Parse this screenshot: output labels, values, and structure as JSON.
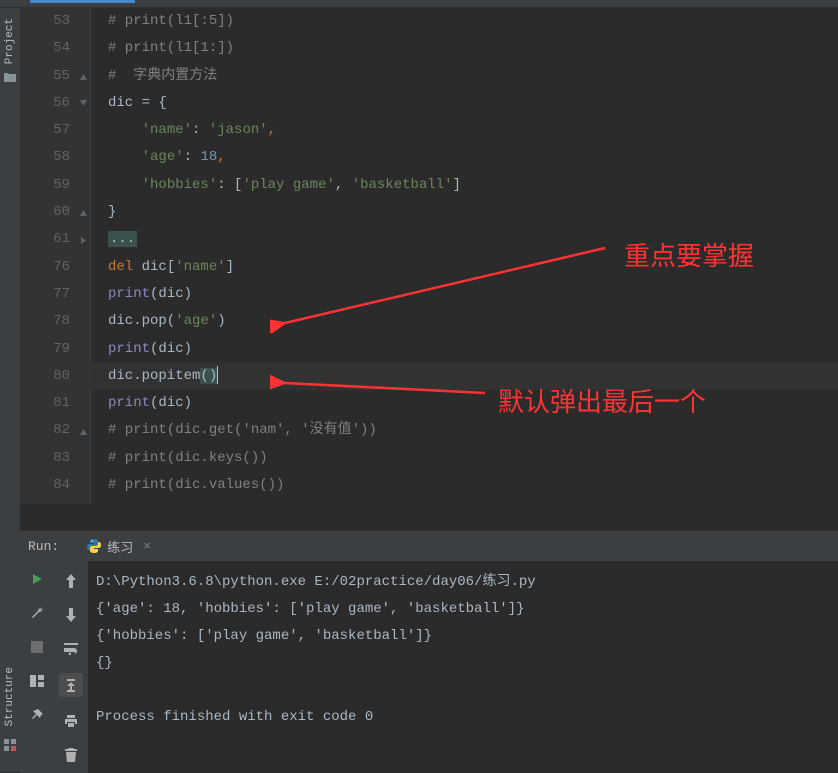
{
  "sidebar": {
    "project_label": "Project",
    "structure_label": "Structure"
  },
  "editor": {
    "lines": [
      {
        "num": "53",
        "tokens": [
          {
            "t": "# print(l1[:5])",
            "c": "c-comment"
          }
        ]
      },
      {
        "num": "54",
        "tokens": [
          {
            "t": "# print(l1[1:])",
            "c": "c-comment"
          }
        ]
      },
      {
        "num": "55",
        "tokens": [
          {
            "t": "#  字典内置方法",
            "c": "c-comment"
          }
        ],
        "fold": "end"
      },
      {
        "num": "56",
        "tokens": [
          {
            "t": "dic = {",
            "c": "c-ident"
          }
        ],
        "fold": "start"
      },
      {
        "num": "57",
        "indent": 1,
        "tokens": [
          {
            "t": "'name'",
            "c": "c-string"
          },
          {
            "t": ": ",
            "c": "c-ident"
          },
          {
            "t": "'jason'",
            "c": "c-string"
          },
          {
            "t": ",",
            "c": "c-punct"
          }
        ]
      },
      {
        "num": "58",
        "indent": 1,
        "tokens": [
          {
            "t": "'age'",
            "c": "c-string"
          },
          {
            "t": ": ",
            "c": "c-ident"
          },
          {
            "t": "18",
            "c": "c-number"
          },
          {
            "t": ",",
            "c": "c-punct"
          }
        ]
      },
      {
        "num": "59",
        "indent": 1,
        "tokens": [
          {
            "t": "'hobbies'",
            "c": "c-string"
          },
          {
            "t": ": [",
            "c": "c-ident"
          },
          {
            "t": "'play game'",
            "c": "c-string"
          },
          {
            "t": ", ",
            "c": "c-ident"
          },
          {
            "t": "'basketball'",
            "c": "c-string"
          },
          {
            "t": "]",
            "c": "c-ident"
          }
        ]
      },
      {
        "num": "60",
        "tokens": [
          {
            "t": "}",
            "c": "c-ident"
          }
        ],
        "fold": "end"
      },
      {
        "num": "61",
        "tokens": [
          {
            "t": "...",
            "c": "c-fold"
          }
        ],
        "fold": "collapsed"
      },
      {
        "num": "76",
        "tokens": [
          {
            "t": "del ",
            "c": "c-keyword"
          },
          {
            "t": "dic[",
            "c": "c-ident"
          },
          {
            "t": "'name'",
            "c": "c-string"
          },
          {
            "t": "]",
            "c": "c-ident"
          }
        ]
      },
      {
        "num": "77",
        "tokens": [
          {
            "t": "print",
            "c": "c-func"
          },
          {
            "t": "(dic)",
            "c": "c-ident"
          }
        ]
      },
      {
        "num": "78",
        "tokens": [
          {
            "t": "dic.pop(",
            "c": "c-ident"
          },
          {
            "t": "'age'",
            "c": "c-string"
          },
          {
            "t": ")",
            "c": "c-ident"
          }
        ]
      },
      {
        "num": "79",
        "tokens": [
          {
            "t": "print",
            "c": "c-func"
          },
          {
            "t": "(dic)",
            "c": "c-ident"
          }
        ]
      },
      {
        "num": "80",
        "highlight": true,
        "tokens": [
          {
            "t": "dic.popitem",
            "c": "c-ident"
          },
          {
            "t": "(",
            "c": "paren-highlight"
          },
          {
            "t": ")",
            "c": "paren-highlight"
          }
        ],
        "cursor": true
      },
      {
        "num": "81",
        "tokens": [
          {
            "t": "print",
            "c": "c-func"
          },
          {
            "t": "(dic)",
            "c": "c-ident"
          }
        ]
      },
      {
        "num": "82",
        "tokens": [
          {
            "t": "# print(dic.get('nam', '没有值'))",
            "c": "c-comment"
          }
        ],
        "fold": "end"
      },
      {
        "num": "83",
        "tokens": [
          {
            "t": "# print(dic.keys())",
            "c": "c-comment"
          }
        ]
      },
      {
        "num": "84",
        "tokens": [
          {
            "t": "# print(dic.values())",
            "c": "c-comment"
          }
        ]
      }
    ]
  },
  "annotations": {
    "label1": "重点要掌握",
    "label2": "默认弹出最后一个"
  },
  "run": {
    "label": "Run:",
    "tab_name": "练习",
    "output": [
      "D:\\Python3.6.8\\python.exe E:/02practice/day06/练习.py",
      "{'age': 18, 'hobbies': ['play game', 'basketball']}",
      "{'hobbies': ['play game', 'basketball']}",
      "{}",
      "",
      "Process finished with exit code 0"
    ]
  }
}
